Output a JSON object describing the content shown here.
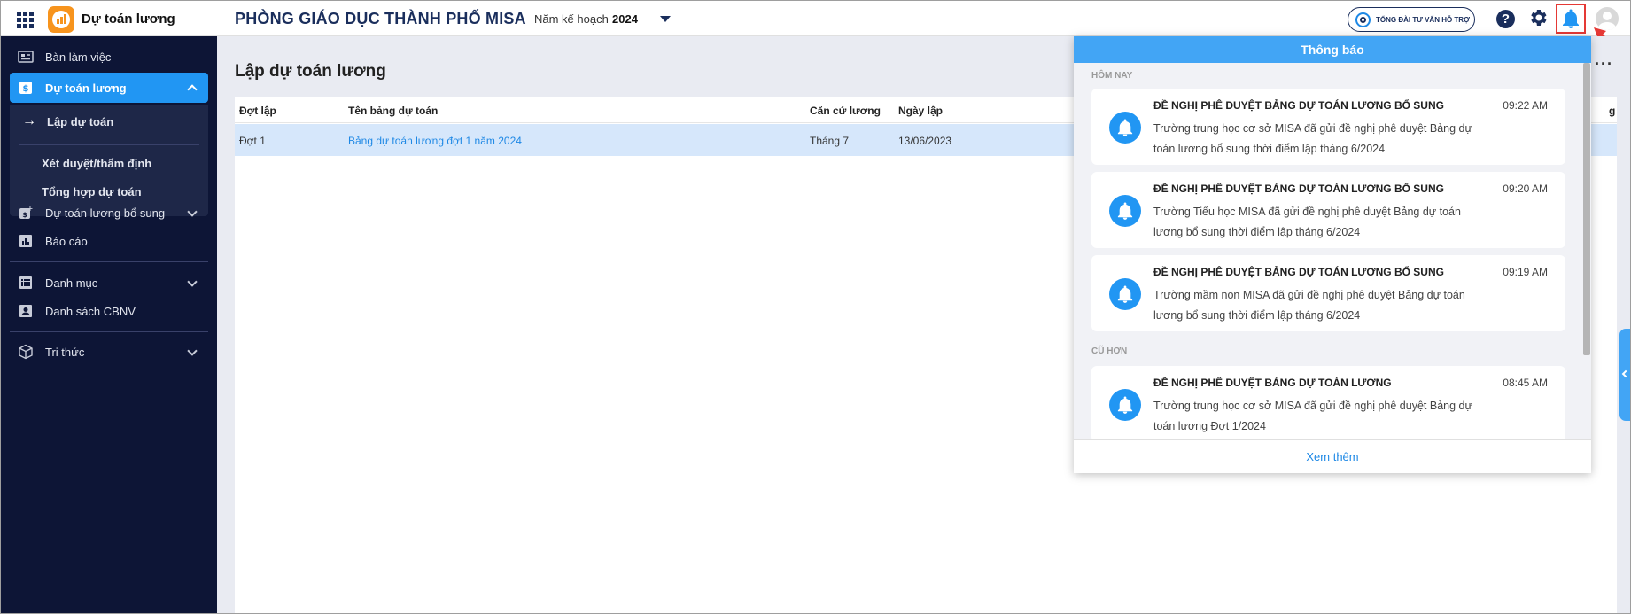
{
  "header": {
    "app_name": "Dự toán lương",
    "org_name": "PHÒNG GIÁO DỤC THÀNH PHỐ MISA",
    "year_label": "Năm kế hoạch",
    "year_value": "2024",
    "support_label": "TỔNG ĐÀI TƯ VẤN HỖ TRỢ",
    "help_glyph": "?",
    "icons": [
      "apps-grid-icon",
      "app-logo-icon",
      "support-phone-icon",
      "help-icon",
      "gear-icon",
      "bell-icon",
      "avatar-icon"
    ]
  },
  "sidebar": {
    "items": [
      {
        "label": "Bàn làm việc",
        "icon": "desk-icon"
      },
      {
        "label": "Dự toán lương",
        "icon": "salary-icon",
        "active": true
      },
      {
        "label": "Dự toán lương bổ sung",
        "icon": "salary-add-icon"
      },
      {
        "label": "Báo cáo",
        "icon": "report-icon"
      },
      {
        "label": "Danh mục",
        "icon": "list-icon"
      },
      {
        "label": "Danh sách CBNV",
        "icon": "staff-icon"
      },
      {
        "label": "Tri thức",
        "icon": "cube-icon"
      }
    ],
    "subitems": [
      {
        "label": "Lập dự toán",
        "active": true
      },
      {
        "label": "Xét duyệt/thẩm định"
      },
      {
        "label": "Tổng hợp dự toán"
      }
    ],
    "current_arrow": "→"
  },
  "main": {
    "title": "Lập dự toán lương",
    "more_glyph": "···",
    "table": {
      "headers": [
        "Đợt lập",
        "Tên bảng dự toán",
        "Căn cứ lương",
        "Ngày lập"
      ],
      "rows": [
        {
          "dot_lap": "Đợt 1",
          "ten": "Bảng dự toán lương đợt 1 năm 2024",
          "can_cu": "Tháng 7",
          "ngay_lap": "13/06/2023"
        }
      ],
      "cut_header_tail": "g"
    }
  },
  "notifications": {
    "title": "Thông báo",
    "section_today": "HÔM NAY",
    "section_older": "CŨ HƠN",
    "items": [
      {
        "title": "ĐỀ NGHỊ PHÊ DUYỆT BẢNG DỰ TOÁN LƯƠNG BỔ SUNG",
        "time": "09:22 AM",
        "body": "Trường trung học cơ sở MISA đã gửi đề nghị phê duyệt Bảng dự toán lương bổ sung thời điểm lập tháng 6/2024"
      },
      {
        "title": "ĐỀ NGHỊ PHÊ DUYỆT BẢNG DỰ TOÁN LƯƠNG BỔ SUNG",
        "time": "09:20 AM",
        "body": "Trường Tiểu học MISA đã gửi đề nghị phê duyệt Bảng dự toán lương bổ sung thời điểm lập tháng 6/2024"
      },
      {
        "title": "ĐỀ NGHỊ PHÊ DUYỆT BẢNG DỰ TOÁN LƯƠNG BỔ SUNG",
        "time": "09:19 AM",
        "body": "Trường mầm non MISA đã gửi đề nghị phê duyệt Bảng dự toán lương bổ sung thời điểm lập tháng 6/2024"
      },
      {
        "title": "ĐỀ NGHỊ PHÊ DUYỆT BẢNG DỰ TOÁN LƯƠNG",
        "time": "08:45 AM",
        "body": "Trường trung học cơ sở MISA đã gửi đề nghị phê duyệt Bảng dự toán lương Đợt 1/2024"
      }
    ],
    "see_more": "Xem thêm"
  },
  "colors": {
    "sidebar_bg": "#0d1536",
    "accent": "#2196f3",
    "notif_header": "#42a5f5",
    "highlight_box": "#e53935"
  }
}
